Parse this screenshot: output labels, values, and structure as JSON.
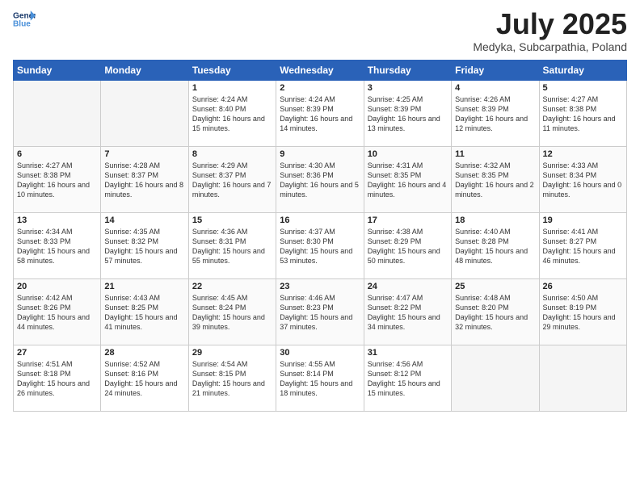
{
  "logo": {
    "line1": "General",
    "line2": "Blue"
  },
  "title": "July 2025",
  "subtitle": "Medyka, Subcarpathia, Poland",
  "days_of_week": [
    "Sunday",
    "Monday",
    "Tuesday",
    "Wednesday",
    "Thursday",
    "Friday",
    "Saturday"
  ],
  "weeks": [
    [
      {
        "day": "",
        "empty": true
      },
      {
        "day": "",
        "empty": true
      },
      {
        "day": "1",
        "sunrise": "4:24 AM",
        "sunset": "8:40 PM",
        "daylight": "16 hours and 15 minutes."
      },
      {
        "day": "2",
        "sunrise": "4:24 AM",
        "sunset": "8:39 PM",
        "daylight": "16 hours and 14 minutes."
      },
      {
        "day": "3",
        "sunrise": "4:25 AM",
        "sunset": "8:39 PM",
        "daylight": "16 hours and 13 minutes."
      },
      {
        "day": "4",
        "sunrise": "4:26 AM",
        "sunset": "8:39 PM",
        "daylight": "16 hours and 12 minutes."
      },
      {
        "day": "5",
        "sunrise": "4:27 AM",
        "sunset": "8:38 PM",
        "daylight": "16 hours and 11 minutes."
      }
    ],
    [
      {
        "day": "6",
        "sunrise": "4:27 AM",
        "sunset": "8:38 PM",
        "daylight": "16 hours and 10 minutes."
      },
      {
        "day": "7",
        "sunrise": "4:28 AM",
        "sunset": "8:37 PM",
        "daylight": "16 hours and 8 minutes."
      },
      {
        "day": "8",
        "sunrise": "4:29 AM",
        "sunset": "8:37 PM",
        "daylight": "16 hours and 7 minutes."
      },
      {
        "day": "9",
        "sunrise": "4:30 AM",
        "sunset": "8:36 PM",
        "daylight": "16 hours and 5 minutes."
      },
      {
        "day": "10",
        "sunrise": "4:31 AM",
        "sunset": "8:35 PM",
        "daylight": "16 hours and 4 minutes."
      },
      {
        "day": "11",
        "sunrise": "4:32 AM",
        "sunset": "8:35 PM",
        "daylight": "16 hours and 2 minutes."
      },
      {
        "day": "12",
        "sunrise": "4:33 AM",
        "sunset": "8:34 PM",
        "daylight": "16 hours and 0 minutes."
      }
    ],
    [
      {
        "day": "13",
        "sunrise": "4:34 AM",
        "sunset": "8:33 PM",
        "daylight": "15 hours and 58 minutes."
      },
      {
        "day": "14",
        "sunrise": "4:35 AM",
        "sunset": "8:32 PM",
        "daylight": "15 hours and 57 minutes."
      },
      {
        "day": "15",
        "sunrise": "4:36 AM",
        "sunset": "8:31 PM",
        "daylight": "15 hours and 55 minutes."
      },
      {
        "day": "16",
        "sunrise": "4:37 AM",
        "sunset": "8:30 PM",
        "daylight": "15 hours and 53 minutes."
      },
      {
        "day": "17",
        "sunrise": "4:38 AM",
        "sunset": "8:29 PM",
        "daylight": "15 hours and 50 minutes."
      },
      {
        "day": "18",
        "sunrise": "4:40 AM",
        "sunset": "8:28 PM",
        "daylight": "15 hours and 48 minutes."
      },
      {
        "day": "19",
        "sunrise": "4:41 AM",
        "sunset": "8:27 PM",
        "daylight": "15 hours and 46 minutes."
      }
    ],
    [
      {
        "day": "20",
        "sunrise": "4:42 AM",
        "sunset": "8:26 PM",
        "daylight": "15 hours and 44 minutes."
      },
      {
        "day": "21",
        "sunrise": "4:43 AM",
        "sunset": "8:25 PM",
        "daylight": "15 hours and 41 minutes."
      },
      {
        "day": "22",
        "sunrise": "4:45 AM",
        "sunset": "8:24 PM",
        "daylight": "15 hours and 39 minutes."
      },
      {
        "day": "23",
        "sunrise": "4:46 AM",
        "sunset": "8:23 PM",
        "daylight": "15 hours and 37 minutes."
      },
      {
        "day": "24",
        "sunrise": "4:47 AM",
        "sunset": "8:22 PM",
        "daylight": "15 hours and 34 minutes."
      },
      {
        "day": "25",
        "sunrise": "4:48 AM",
        "sunset": "8:20 PM",
        "daylight": "15 hours and 32 minutes."
      },
      {
        "day": "26",
        "sunrise": "4:50 AM",
        "sunset": "8:19 PM",
        "daylight": "15 hours and 29 minutes."
      }
    ],
    [
      {
        "day": "27",
        "sunrise": "4:51 AM",
        "sunset": "8:18 PM",
        "daylight": "15 hours and 26 minutes."
      },
      {
        "day": "28",
        "sunrise": "4:52 AM",
        "sunset": "8:16 PM",
        "daylight": "15 hours and 24 minutes."
      },
      {
        "day": "29",
        "sunrise": "4:54 AM",
        "sunset": "8:15 PM",
        "daylight": "15 hours and 21 minutes."
      },
      {
        "day": "30",
        "sunrise": "4:55 AM",
        "sunset": "8:14 PM",
        "daylight": "15 hours and 18 minutes."
      },
      {
        "day": "31",
        "sunrise": "4:56 AM",
        "sunset": "8:12 PM",
        "daylight": "15 hours and 15 minutes."
      },
      {
        "day": "",
        "empty": true
      },
      {
        "day": "",
        "empty": true
      }
    ]
  ]
}
